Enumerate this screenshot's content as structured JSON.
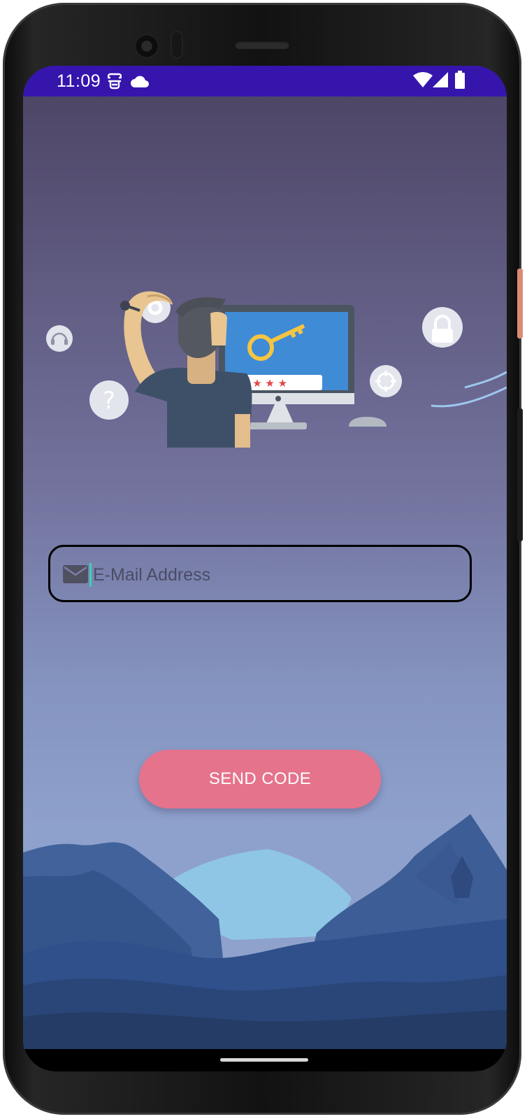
{
  "status_bar": {
    "time": "11:09",
    "left_icons": [
      "sim-card-icon",
      "cloud-icon"
    ],
    "right_icons": [
      "wifi-icon",
      "cell-signal-icon",
      "battery-icon"
    ],
    "color": "#3615ad"
  },
  "email_field": {
    "placeholder": "E-Mail Address",
    "value": "",
    "icon": "mail-icon"
  },
  "send_button": {
    "label": "SEND CODE",
    "color": "#e5738b"
  },
  "illustration": {
    "icons": [
      "headset-icon",
      "question-icon",
      "gear-icon",
      "key-icon",
      "lock-icon",
      "crosshair-icon"
    ]
  }
}
